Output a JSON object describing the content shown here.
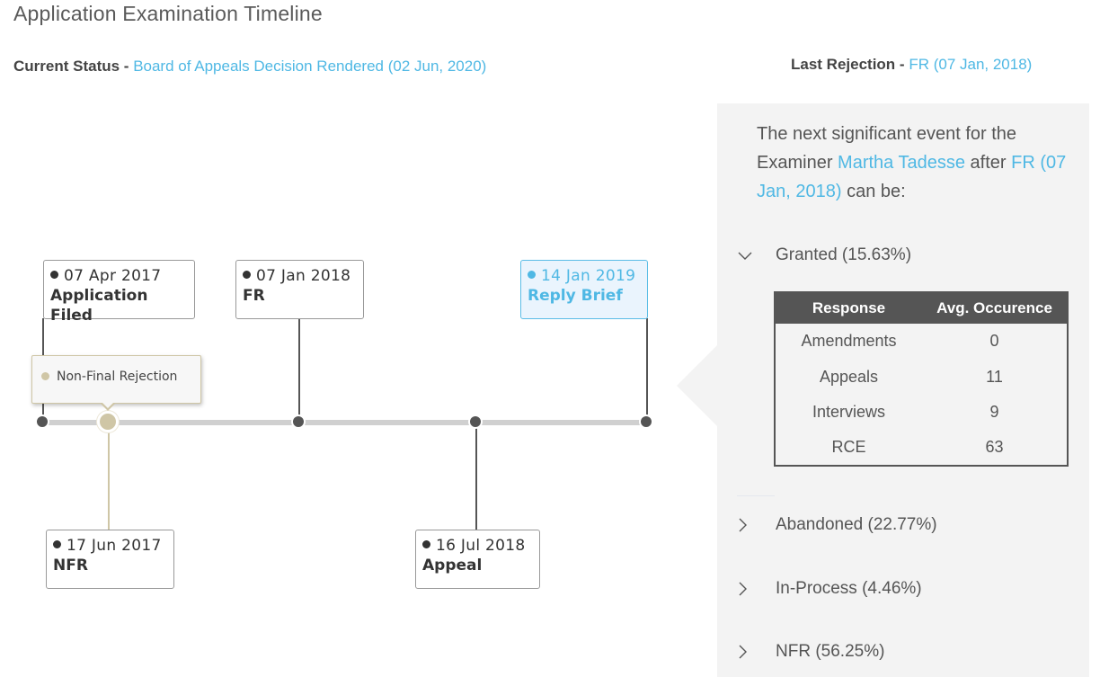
{
  "header": {
    "title": "Application Examination Timeline",
    "current_status_label": "Current Status - ",
    "current_status_value": "Board of Appeals Decision Rendered (02 Jun, 2020)",
    "last_rejection_label": "Last Rejection - ",
    "last_rejection_value": "FR (07 Jan, 2018)"
  },
  "timeline": {
    "events": [
      {
        "date": "07 Apr 2017",
        "name": "Application Filed",
        "position": "above"
      },
      {
        "date": "17 Jun 2017",
        "name": "NFR",
        "position": "below"
      },
      {
        "date": "07 Jan 2018",
        "name": "FR",
        "position": "above"
      },
      {
        "date": "16 Jul 2018",
        "name": "Appeal",
        "position": "below"
      },
      {
        "date": "14 Jan 2019",
        "name": "Reply Brief",
        "position": "above",
        "active": true
      }
    ],
    "tooltip": "Non-Final Rejection",
    "colors": {
      "accent": "#4fb8e4",
      "node": "#555555",
      "nfr_node": "#cfc6a6",
      "track": "#d0d0d0"
    }
  },
  "panel": {
    "intro_prefix": "The next significant event for the Examiner ",
    "examiner": "Martha Tadesse",
    "intro_middle": " after ",
    "event_ref": "FR (07 Jan, 2018)",
    "intro_suffix": " can be:",
    "outcomes": [
      {
        "label": "Granted (15.63%)",
        "expanded": true
      },
      {
        "label": "Abandoned (22.77%)",
        "expanded": false
      },
      {
        "label": "In-Process (4.46%)",
        "expanded": false
      },
      {
        "label": "NFR (56.25%)",
        "expanded": false
      }
    ],
    "table": {
      "headers": [
        "Response",
        "Avg. Occurence"
      ],
      "rows": [
        [
          "Amendments",
          "0"
        ],
        [
          "Appeals",
          "11"
        ],
        [
          "Interviews",
          "9"
        ],
        [
          "RCE",
          "63"
        ]
      ]
    }
  }
}
